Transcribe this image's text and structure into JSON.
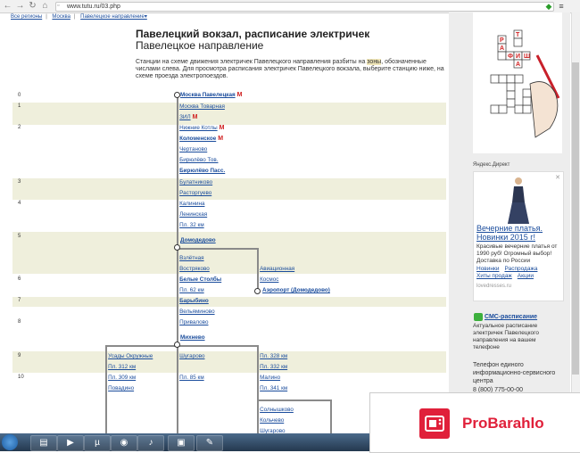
{
  "browser": {
    "url": "www.tutu.ru/03.php"
  },
  "breadcrumb": [
    "Все регионы",
    "Москва",
    "Павелецкое направление▾"
  ],
  "header": {
    "title": "Павелецкий вокзал, расписание электричек",
    "subtitle": "Павелецкое направление",
    "intro_before": "Станции на схеме движения электричек Павелецкого направления разбиты на ",
    "intro_highlight": "зоны",
    "intro_after": ", обозначенные числами слева. Для просмотра расписания электричек Павелецкого вокзала, выберите станцию ниже, на схеме проезда электропоездов."
  },
  "zones": [
    "0",
    "1",
    "2",
    "3",
    "4",
    "5",
    "6",
    "7",
    "8",
    "9",
    "10"
  ],
  "stations": {
    "moskva_pav": "Москва Павелецкая",
    "moskva_tov": "Москва Товарная",
    "zil": "ЗИЛ",
    "nizhnie_kotly": "Нижние Котлы",
    "kolomenskoe": "Коломенское",
    "chertanovo": "Чертаново",
    "biryulevo_tov": "Бирюлёво Тов.",
    "biryulevo_pass": "Бирюлёво Пасс.",
    "bulatnikovo": "Булатниково",
    "rastorguevo": "Расторгуево",
    "kalinina": "Калинина",
    "leninskaya": "Ленинская",
    "pl32": "Пл. 32 км",
    "domodedovo": "Домодедово",
    "vzletnaya": "Взлётная",
    "vostryakovo": "Востряково",
    "aviacionnaya": "Авиационная",
    "belye_stolby": "Белые Столбы",
    "kosmos": "Космос",
    "pl62": "Пл. 62 км",
    "airport": "Аэропорт (Домодедово)",
    "barybino": "Барыбино",
    "velyaminovo": "Вельяминово",
    "privalovo": "Привалово",
    "mikhnevo": "Михнево",
    "usady": "Усады Окружные",
    "pl312": "Пл. 312 км",
    "pl309": "Пл. 309 км",
    "povadino": "Повадино",
    "shugarovo": "Шугарово",
    "pl85": "Пл. 85 км",
    "pl328": "Пл. 328 км",
    "pl332": "Пл. 332 км",
    "malino": "Малино",
    "pl341": "Пл. 341 км",
    "solnyshkovo": "Солнышково",
    "kolycheovo": "Кольчево",
    "shugarovo2": "Шугарово"
  },
  "sidebar": {
    "ad_label": "Яндекс.Директ",
    "ad_title": "Вечерние платья. Новинки 2015 г!",
    "ad_text": "Красивые вечерние платья от 1990 руб! Огромный выбор! Доставка по России",
    "ad_links": [
      "Новинки",
      "Распродажа",
      "Хиты продаж",
      "Акции"
    ],
    "ad_domain": "lovedresses.ru",
    "crossword_letters": [
      "А",
      "Ф",
      "И",
      "Ш",
      "А",
      "Р",
      "Т"
    ],
    "sms_title": "СМС-расписание",
    "sms_text": "Актуальное расписание электричек Павелецкого направления на вашем телефоне",
    "info_text": "Телефон единого информационно-сервисного центра",
    "info_phone": "8 (800) 775-00-00 (круглосуточно, звонок"
  },
  "overlay": {
    "brand_pro": "Pro",
    "brand_rest": "Barahlo"
  },
  "colors": {
    "link": "#1a4c9c",
    "zone_band": "#efefdc",
    "metro": "#d02020",
    "brand": "#e0203a"
  }
}
